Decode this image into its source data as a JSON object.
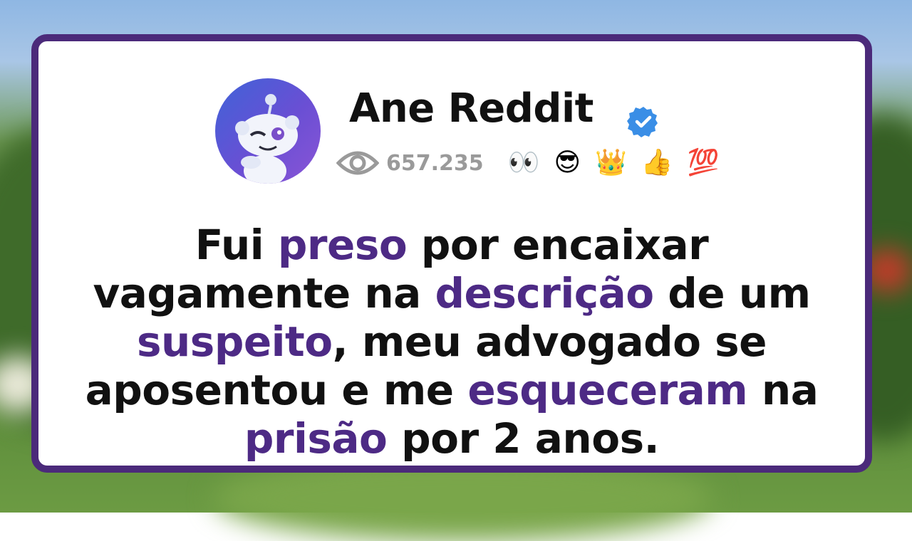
{
  "author": {
    "name": "Ane Reddit",
    "verified": true,
    "views": "657.235"
  },
  "reactions": [
    "👀",
    "😎",
    "👑",
    "👍",
    "💯"
  ],
  "post": {
    "segments": [
      {
        "text": "Fui ",
        "highlight": false
      },
      {
        "text": "preso",
        "highlight": true
      },
      {
        "text": " por encaixar",
        "highlight": false
      },
      {
        "text": "vagamente na ",
        "highlight": false
      },
      {
        "text": "descrição",
        "highlight": true
      },
      {
        "text": " de um",
        "highlight": false
      },
      {
        "text": "suspeito",
        "highlight": true
      },
      {
        "text": ", meu advogado se",
        "highlight": false
      },
      {
        "text": "aposentou e me ",
        "highlight": false
      },
      {
        "text": "esqueceram",
        "highlight": true
      },
      {
        "text": " na",
        "highlight": false
      },
      {
        "text": "prisão",
        "highlight": true
      },
      {
        "text": " por 2 anos.",
        "highlight": false
      }
    ]
  },
  "colors": {
    "border": "#4b2a7a",
    "highlight": "#4d2a85",
    "verified": "#3a8ee6"
  }
}
